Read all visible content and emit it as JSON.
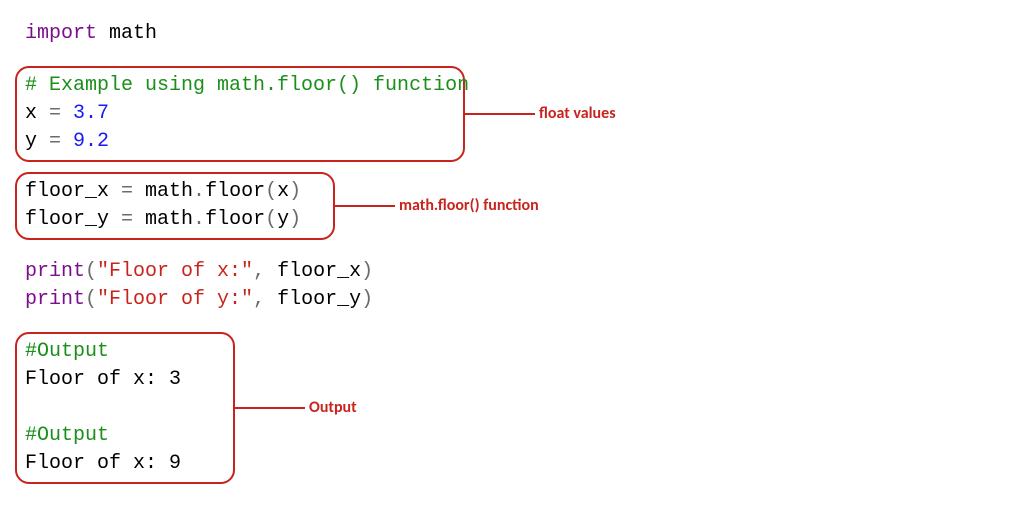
{
  "code": {
    "line1_import": "import",
    "line1_math": " math",
    "block1": {
      "comment": "# Example using math.floor() function",
      "l2_x": "x ",
      "l2_eq": "=",
      "l2_val": " 3.7",
      "l3_y": "y ",
      "l3_eq": "=",
      "l3_val": " 9.2"
    },
    "block2": {
      "l1_a": "floor_x ",
      "l1_eq": "=",
      "l1_b": " math",
      "l1_dot": ".",
      "l1_c": "floor",
      "l1_p1": "(",
      "l1_x": "x",
      "l1_p2": ")",
      "l2_a": "floor_y ",
      "l2_eq": "=",
      "l2_b": " math",
      "l2_dot": ".",
      "l2_c": "floor",
      "l2_p1": "(",
      "l2_y": "y",
      "l2_p2": ")"
    },
    "prints": {
      "p": "print",
      "o": "(",
      "s1": "\"Floor of x:\"",
      "cm": ",",
      "sp": " ",
      "a1": "floor_x",
      "c": ")",
      "s2": "\"Floor of y:\"",
      "a2": "floor_y"
    },
    "out": {
      "c1": "#Output",
      "l1": "Floor of x: 3",
      "c2": "#Output",
      "l2": "Floor of x: 9"
    }
  },
  "annotations": {
    "a1": "float values",
    "a2": "math.floor() function",
    "a3": "Output"
  }
}
